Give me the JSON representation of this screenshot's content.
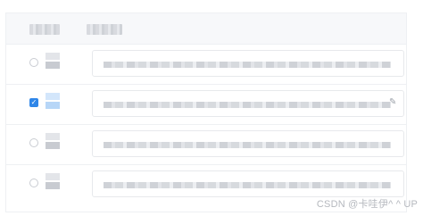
{
  "table": {
    "rows": [
      {
        "selected": false
      },
      {
        "selected": true
      },
      {
        "selected": false
      },
      {
        "selected": false
      }
    ]
  },
  "icons": {
    "edit": "pencil-icon",
    "checkmark": "✓"
  },
  "colors": {
    "accent": "#2f86e8",
    "border": "#eef0f3"
  },
  "watermark": "CSDN @卡哇伊^ ^ UP"
}
